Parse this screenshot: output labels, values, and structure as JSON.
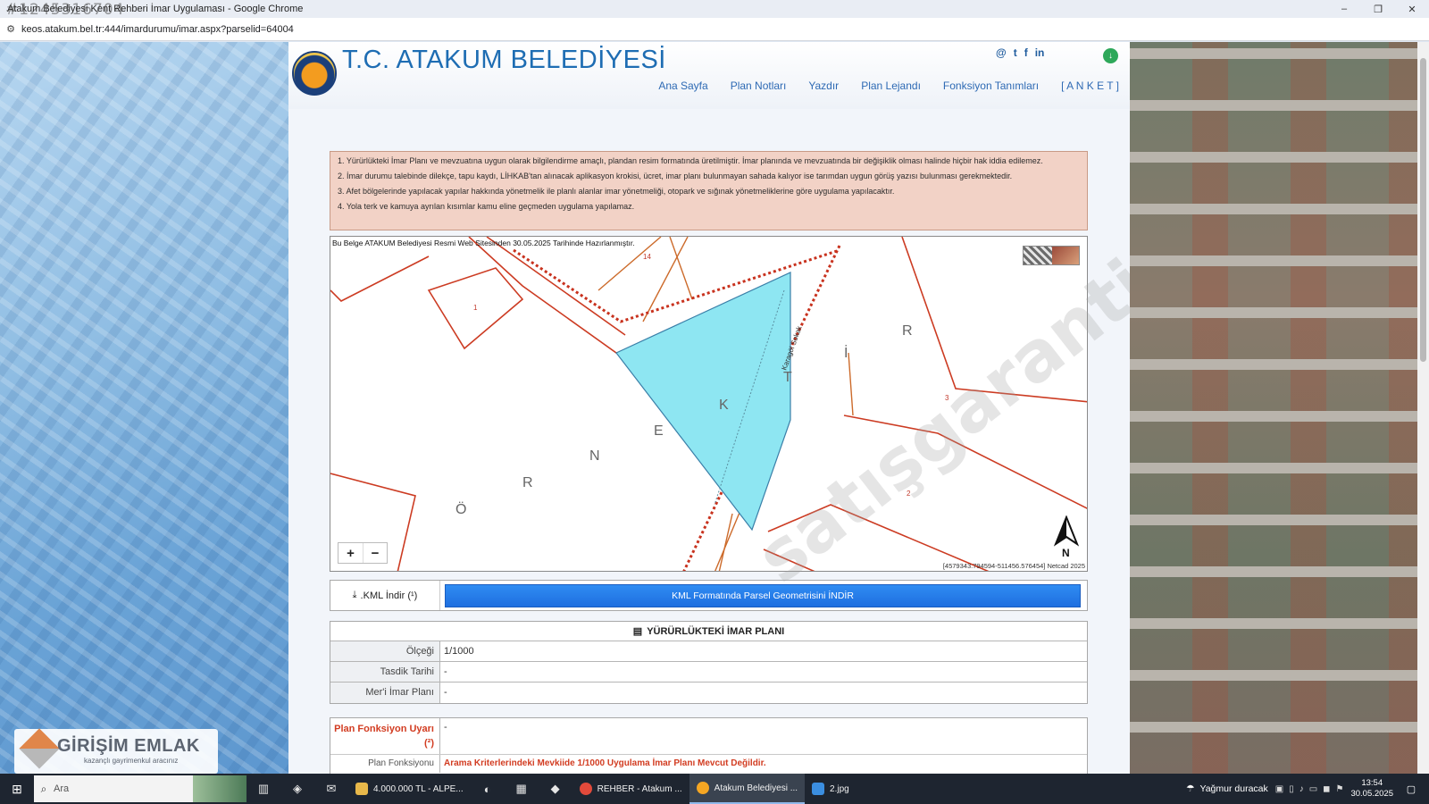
{
  "browser": {
    "window_title": "Atakum Belediyesi Kent Rehberi İmar Uygulaması - Google Chrome",
    "overlay_id": "#1245316704",
    "url": "keos.atakum.bel.tr:444/imardurumu/imar.aspx?parselid=64004",
    "win_minimize": "–",
    "win_restore": "❐",
    "win_close": "✕"
  },
  "site": {
    "logo_text": "T.C. ATAKUM BELEDİYESİ",
    "social": [
      "@",
      "t",
      "f",
      "in"
    ],
    "download_icon": "↓",
    "nav": [
      "Ana Sayfa",
      "Plan Notları",
      "Yazdır",
      "Plan Lejandı",
      "Fonksiyon Tanımları",
      "[ A N K E T ]"
    ]
  },
  "notice": {
    "items": [
      "1. Yürürlükteki İmar Planı ve mevzuatına uygun olarak bilgilendirme amaçlı, plandan resim formatında üretilmiştir. İmar planında ve mevzuatında bir değişiklik olması halinde hiçbir hak iddia edilemez.",
      "2. İmar durumu talebinde dilekçe, tapu kaydı, LİHKAB'tan alınacak aplikasyon krokisi, ücret, imar planı bulunmayan sahada kalıyor ise tarımdan uygun görüş yazısı bulunması gerekmektedir.",
      "3. Afet bölgelerinde yapılacak yapılar hakkında yönetmelik ile planlı alanlar imar yönetmeliği, otopark ve sığınak yönetmeliklerine göre uygulama yapılacaktır.",
      "4. Yola terk ve kamuya ayrılan kısımlar kamu eline geçmeden uygulama yapılamaz."
    ]
  },
  "map": {
    "caption": "Bu Belge ATAKUM Belediyesi Resmi Web Sitesinden 30.05.2025 Tarihinde Hazırlanmıştır.",
    "zoom_in": "+",
    "zoom_out": "−",
    "coords": "[4579343.794594-511456.576454] Netcad 2025",
    "north_label": "N",
    "parcel_numbers": [
      "1",
      "14",
      "3",
      "2"
    ],
    "road_label": "Karagöl Sokak",
    "area_letters": [
      "Ö",
      "R",
      "N",
      "E",
      "K",
      "T",
      "İ",
      "R"
    ]
  },
  "kml": {
    "label": ".KML İndir (¹)",
    "button": "KML Formatında Parsel Geometrisini İNDİR"
  },
  "plan": {
    "header": "YÜRÜRLÜKTEKİ İMAR PLANI",
    "rows": [
      {
        "label": "Ölçeği",
        "value": "1/1000"
      },
      {
        "label": "Tasdik Tarihi",
        "value": "-"
      },
      {
        "label": "Mer'i İmar Planı",
        "value": "-"
      }
    ]
  },
  "function": {
    "label": "Plan Fonksiyon Uyarı (²)",
    "value": "-",
    "row2_label": "Plan Fonksiyonu",
    "row2_value": "Arama Kriterlerindeki Mevkiide 1/1000 Uygulama İmar Planı Mevcut Değildir."
  },
  "watermark": "satışgaranti",
  "agency": {
    "name": "GİRİŞİM EMLAK",
    "tagline": "kazançlı gayrimenkul aracınız"
  },
  "taskbar": {
    "start": "⊞",
    "search_placeholder": "Ara",
    "apps": [
      {
        "label": "4.000.000 TL - ALPE...",
        "color": "#e8b84a"
      },
      {
        "label": "REHBER - Atakum ...",
        "color": "#e24a3b"
      },
      {
        "label": "Atakum Belediyesi ...",
        "color": "#f5a623"
      },
      {
        "label": "2.jpg",
        "color": "#3b8ee0"
      }
    ],
    "weather": "Yağmur duracak",
    "time": "13:54",
    "date": "30.05.2025"
  },
  "colors": {
    "parcel_fill": "#8ee6f2",
    "parcel_stroke": "#3a7fa8",
    "boundary": "#cc3b22",
    "road": "#cc6a2a",
    "accent_blue": "#1e6db3"
  }
}
